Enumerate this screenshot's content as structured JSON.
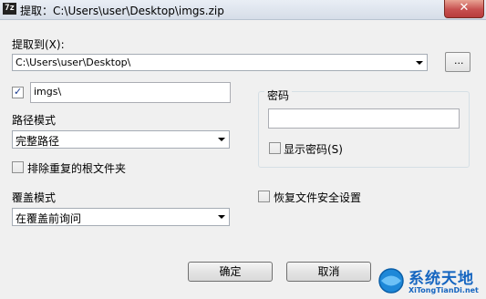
{
  "window": {
    "title": "提取：C:\\Users\\user\\Desktop\\imgs.zip",
    "app_icon": "7z",
    "close_glyph": "✕"
  },
  "extract_to": {
    "label": "提取到(X):",
    "path": "C:\\Users\\user\\Desktop\\",
    "browse_label": "..."
  },
  "subfolder": {
    "checked": true,
    "value": "imgs\\"
  },
  "path_mode": {
    "label": "路径模式",
    "selected": "完整路径"
  },
  "eliminate_dup_root": {
    "label": "排除重复的根文件夹",
    "checked": false
  },
  "overwrite_mode": {
    "label": "覆盖模式",
    "selected": "在覆盖前询问"
  },
  "password": {
    "group_label": "密码",
    "value": "",
    "show_label": "显示密码(S)",
    "show_checked": false
  },
  "restore_security": {
    "label": "恢复文件安全设置",
    "checked": false
  },
  "buttons": {
    "ok": "确定",
    "cancel": "取消"
  },
  "watermark": {
    "name": "系统天地",
    "url": "XiTongTianDi.net"
  }
}
